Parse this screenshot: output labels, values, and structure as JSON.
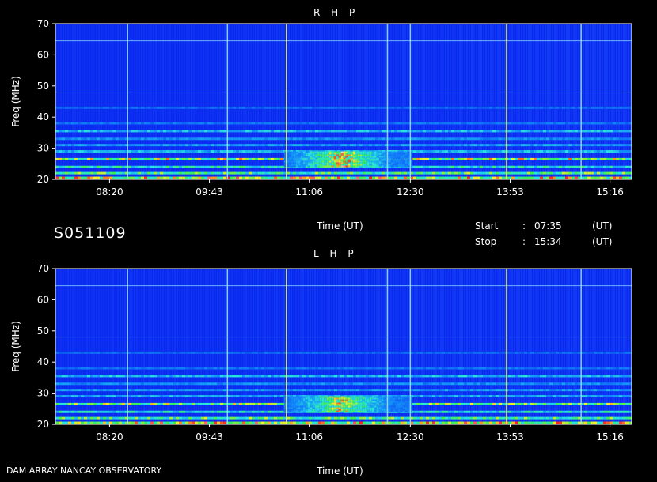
{
  "session_code": "S051109",
  "footer_label": "DAM ARRAY   NANCAY OBSERVATORY",
  "time_axis_label": "Time (UT)",
  "start": {
    "label": "Start",
    "sep": ":",
    "value": "07:35",
    "unit": "(UT)"
  },
  "stop": {
    "label": "Stop",
    "sep": ":",
    "value": "15:34",
    "unit": "(UT)"
  },
  "colors": {
    "background": "#000000",
    "spectrum_base": "#0a28f0",
    "marker_line": "#ffff66",
    "marker_line_alt": "#9fe8ff"
  },
  "chart_data": [
    {
      "type": "heatmap",
      "title": "R H P",
      "ylabel": "Freq (MHz)",
      "xlabel": "Time (UT)",
      "x_range": [
        "07:35",
        "15:34"
      ],
      "ylim": [
        20,
        70
      ],
      "y_ticks": [
        20,
        30,
        40,
        50,
        60,
        70
      ],
      "x_ticks": [
        "08:20",
        "09:43",
        "11:06",
        "12:30",
        "13:53",
        "15:16"
      ],
      "intensity_bands_mhz": [
        {
          "freq": 20.5,
          "level": 0.95
        },
        {
          "freq": 22,
          "level": 0.8
        },
        {
          "freq": 24,
          "level": 0.7
        },
        {
          "freq": 26.5,
          "level": 0.9
        },
        {
          "freq": 29,
          "level": 0.55
        },
        {
          "freq": 31,
          "level": 0.45
        },
        {
          "freq": 33,
          "level": 0.4
        },
        {
          "freq": 35.5,
          "level": 0.55
        },
        {
          "freq": 38,
          "level": 0.3
        },
        {
          "freq": 43,
          "level": 0.25
        }
      ],
      "burst_region": {
        "start": "10:45",
        "end": "12:30",
        "freq_low": 24,
        "freq_high": 29,
        "level": 1.0
      },
      "vertical_markers": [
        "08:35",
        "09:58",
        "10:47",
        "12:11",
        "12:30",
        "13:50",
        "14:52"
      ]
    },
    {
      "type": "heatmap",
      "title": "L H P",
      "ylabel": "Freq (MHz)",
      "xlabel": "Time (UT)",
      "x_range": [
        "07:35",
        "15:34"
      ],
      "ylim": [
        20,
        70
      ],
      "y_ticks": [
        20,
        30,
        40,
        50,
        60,
        70
      ],
      "x_ticks": [
        "08:20",
        "09:43",
        "11:06",
        "12:30",
        "13:53",
        "15:16"
      ],
      "intensity_bands_mhz": [
        {
          "freq": 20.5,
          "level": 0.95
        },
        {
          "freq": 22,
          "level": 0.8
        },
        {
          "freq": 24,
          "level": 0.65
        },
        {
          "freq": 26.5,
          "level": 0.85
        },
        {
          "freq": 29,
          "level": 0.5
        },
        {
          "freq": 31,
          "level": 0.45
        },
        {
          "freq": 33,
          "level": 0.4
        },
        {
          "freq": 35.5,
          "level": 0.55
        },
        {
          "freq": 38,
          "level": 0.3
        },
        {
          "freq": 43,
          "level": 0.25
        }
      ],
      "burst_region": {
        "start": "10:45",
        "end": "12:30",
        "freq_low": 24,
        "freq_high": 29,
        "level": 0.95
      },
      "vertical_markers": [
        "08:35",
        "09:58",
        "10:47",
        "12:11",
        "12:30",
        "13:50",
        "14:52"
      ]
    }
  ]
}
